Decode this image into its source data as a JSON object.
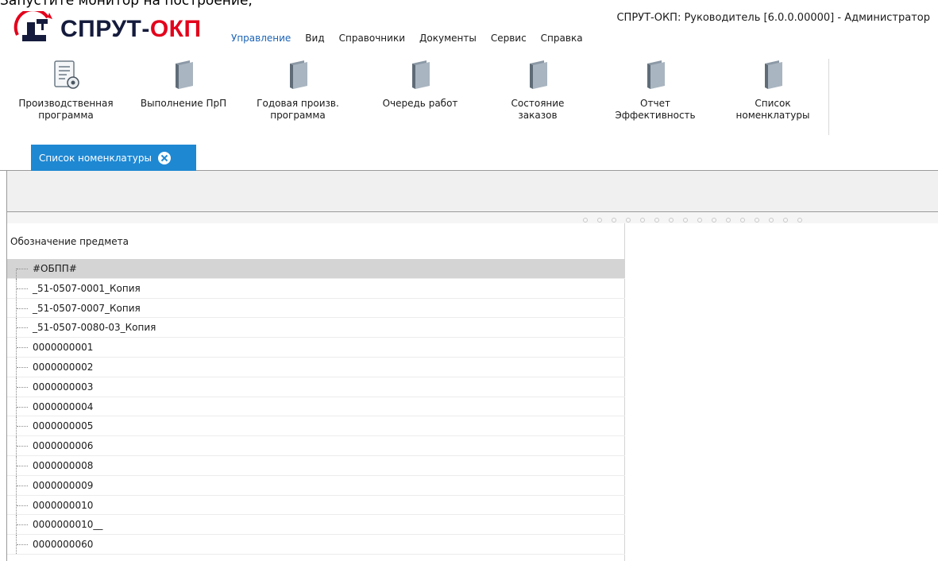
{
  "caption": "Запустите монитор на построение,",
  "logo": {
    "part1": "СПРУТ-",
    "part2": "ОКП"
  },
  "window_title": "СПРУТ-ОКП: Руководитель [6.0.0.00000] - Администратор",
  "menu": [
    {
      "label": "Управление",
      "active": true
    },
    {
      "label": "Вид"
    },
    {
      "label": "Справочники"
    },
    {
      "label": "Документы"
    },
    {
      "label": "Сервис"
    },
    {
      "label": "Справка"
    }
  ],
  "ribbon": [
    {
      "label": "Производственная\nпрограмма",
      "icon": "document-gear-icon"
    },
    {
      "label": "Выполнение ПрП",
      "icon": "book-icon"
    },
    {
      "label": "Годовая произв.\nпрограмма",
      "icon": "book-icon"
    },
    {
      "label": "Очередь работ",
      "icon": "book-icon"
    },
    {
      "label": "Состояние\nзаказов",
      "icon": "book-icon"
    },
    {
      "label": "Отчет\nЭффективность",
      "icon": "book-icon"
    },
    {
      "label": "Список\nноменклатуры",
      "icon": "book-icon"
    }
  ],
  "tab": {
    "label": "Список номенклатуры"
  },
  "tree": {
    "column_header": "Обозначение предмета",
    "items": [
      "#ОБПП#",
      "_51-0507-0001_Копия",
      "_51-0507-0007_Копия",
      "_51-0507-0080-03_Копия",
      "0000000001",
      "0000000002",
      "0000000003",
      "0000000004",
      "0000000005",
      "0000000006",
      "0000000008",
      "0000000009",
      "0000000010",
      "0000000010__",
      "0000000060"
    ],
    "selected_index": 0
  },
  "colors": {
    "accent": "#1e88d3",
    "menu_active": "#1b63b6",
    "logo_dark": "#151b3c",
    "logo_red": "#e3001b",
    "selected_row": "#d4d4d4"
  }
}
